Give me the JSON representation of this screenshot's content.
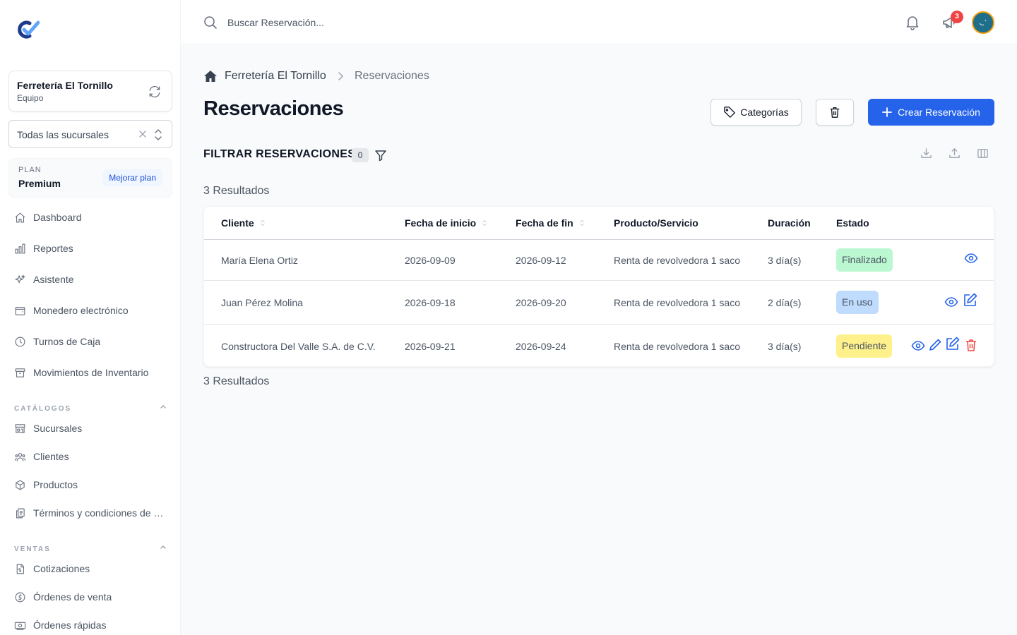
{
  "team": {
    "name": "Ferretería El Tornillo",
    "subtitle": "Equipo"
  },
  "branch_select": {
    "value": "Todas las sucursales"
  },
  "plan": {
    "label": "PLAN",
    "name": "Premium",
    "upgrade_label": "Mejorar plan"
  },
  "nav": {
    "main": [
      {
        "label": "Dashboard",
        "icon": "home-icon"
      },
      {
        "label": "Reportes",
        "icon": "bar-chart-icon"
      },
      {
        "label": "Asistente",
        "icon": "sparkles-icon"
      },
      {
        "label": "Monedero electrónico",
        "icon": "wallet-icon"
      },
      {
        "label": "Turnos de Caja",
        "icon": "clock-icon"
      },
      {
        "label": "Movimientos de Inventario",
        "icon": "archive-box-icon"
      }
    ],
    "catalogos": {
      "label": "CATÁLOGOS",
      "items": [
        {
          "label": "Sucursales",
          "icon": "storefront-icon"
        },
        {
          "label": "Clientes",
          "icon": "users-icon"
        },
        {
          "label": "Productos",
          "icon": "cube-icon"
        },
        {
          "label": "Términos y condiciones de reservaciones",
          "icon": "document-duplicate-icon"
        }
      ]
    },
    "ventas": {
      "label": "VENTAS",
      "items": [
        {
          "label": "Cotizaciones",
          "icon": "document-dollar-icon"
        },
        {
          "label": "Órdenes de venta",
          "icon": "dollar-circle-icon"
        },
        {
          "label": "Órdenes rápidas",
          "icon": "banknotes-icon"
        }
      ]
    }
  },
  "topbar": {
    "search_placeholder": "Buscar Reservación...",
    "notification_badge": "3"
  },
  "breadcrumb": {
    "root": "Ferretería El Tornillo",
    "current": "Reservaciones"
  },
  "page": {
    "title": "Reservaciones",
    "categories_label": "Categorías",
    "create_label": "Crear Reservación",
    "filter_title": "FILTRAR RESERVACIONES",
    "filter_count": "0",
    "results_top": "3 Resultados",
    "results_bottom": "3 Resultados"
  },
  "table": {
    "columns": [
      "Cliente",
      "Fecha de inicio",
      "Fecha de fin",
      "Producto/Servicio",
      "Duración",
      "Estado"
    ],
    "rows": [
      {
        "cliente": "María Elena Ortiz",
        "inicio": "2026-09-09",
        "fin": "2026-09-12",
        "producto": "Renta de revolvedora 1 saco",
        "duracion": "3 día(s)",
        "estado": "Finalizado"
      },
      {
        "cliente": "Juan Pérez Molina",
        "inicio": "2026-09-18",
        "fin": "2026-09-20",
        "producto": "Renta de revolvedora 1 saco",
        "duracion": "2 día(s)",
        "estado": "En uso"
      },
      {
        "cliente": "Constructora Del Valle S.A. de C.V.",
        "inicio": "2026-09-21",
        "fin": "2026-09-24",
        "producto": "Renta de revolvedora 1 saco",
        "duracion": "3 día(s)",
        "estado": "Pendiente"
      }
    ]
  },
  "colors": {
    "primary": "#2563eb",
    "finalizado_bg": "#bbf7d0",
    "en_uso_bg": "#bfdbfe",
    "pendiente_bg": "#fef08a",
    "danger": "#ef4444"
  }
}
